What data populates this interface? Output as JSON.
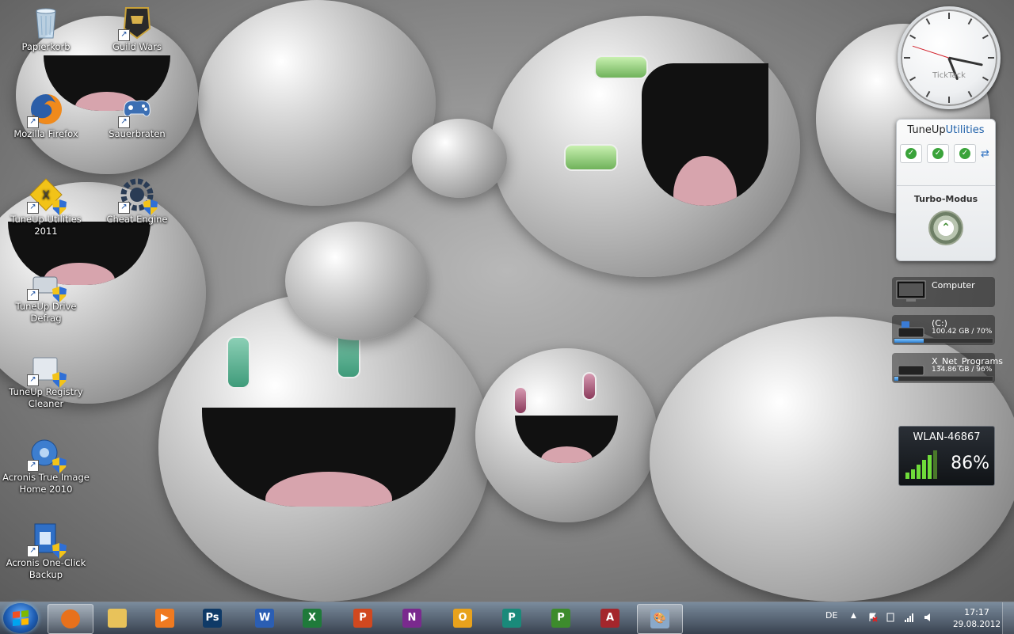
{
  "desktop_icons": [
    {
      "label": "Papierkorb",
      "icon": "recycle-bin-icon"
    },
    {
      "label": "Guild Wars",
      "icon": "guild-wars-icon"
    },
    {
      "label": "Mozilla Firefox",
      "icon": "firefox-icon"
    },
    {
      "label": "Sauerbraten",
      "icon": "gamepad-icon"
    },
    {
      "label": "TuneUp Utilities 2011",
      "icon": "tuneup-icon"
    },
    {
      "label": "Cheat Engine",
      "icon": "cheat-engine-icon"
    },
    {
      "label": "TuneUp Drive Defrag",
      "icon": "defrag-icon"
    },
    {
      "label": "TuneUp Registry Cleaner",
      "icon": "registry-cleaner-icon"
    },
    {
      "label": "Acronis True Image Home 2010",
      "icon": "acronis-true-image-icon"
    },
    {
      "label": "Acronis One-Click Backup",
      "icon": "acronis-backup-icon"
    }
  ],
  "clock_gadget": {
    "brand": "TickTack",
    "time_shown": "17:17:48"
  },
  "tuneup_gadget": {
    "title_part1": "TuneUp",
    "title_part2": "Utilities",
    "check_count": 3,
    "turbo_label": "Turbo-Modus"
  },
  "drives": [
    {
      "name": "Computer",
      "info": "",
      "used_fraction": null
    },
    {
      "name": "(C:)",
      "info": "100.42 GB / 70%",
      "used_fraction": 0.3
    },
    {
      "name": "X_Net_Programs",
      "info": "134.86 GB / 96%",
      "used_fraction": 0.04
    }
  ],
  "wlan_gadget": {
    "network": "WLAN-46867",
    "signal": "86%"
  },
  "taskbar": {
    "apps": [
      {
        "name": "firefox",
        "letter": "",
        "color": "#e8711c",
        "active": true
      },
      {
        "name": "explorer",
        "letter": "",
        "color": "#e8c25a",
        "active": false
      },
      {
        "name": "media-player",
        "letter": "▶",
        "color": "#f07a20",
        "active": false
      },
      {
        "name": "photoshop",
        "letter": "Ps",
        "color": "#0f3a67",
        "active": false
      },
      {
        "name": "word",
        "letter": "W",
        "color": "#2b5eb3",
        "active": false
      },
      {
        "name": "excel",
        "letter": "X",
        "color": "#1f7a3a",
        "active": false
      },
      {
        "name": "powerpoint",
        "letter": "P",
        "color": "#d1481f",
        "active": false
      },
      {
        "name": "onenote",
        "letter": "N",
        "color": "#7a2a8e",
        "active": false
      },
      {
        "name": "outlook",
        "letter": "O",
        "color": "#e8a21c",
        "active": false
      },
      {
        "name": "publisher",
        "letter": "P",
        "color": "#1a8a7a",
        "active": false
      },
      {
        "name": "project",
        "letter": "P",
        "color": "#3d8b2c",
        "active": false
      },
      {
        "name": "access",
        "letter": "A",
        "color": "#a4262c",
        "active": false
      },
      {
        "name": "paint",
        "letter": "🎨",
        "color": "#8aa9c9",
        "active": true
      }
    ],
    "tray": {
      "language": "DE",
      "time": "17:17",
      "date": "29.08.2012"
    }
  }
}
